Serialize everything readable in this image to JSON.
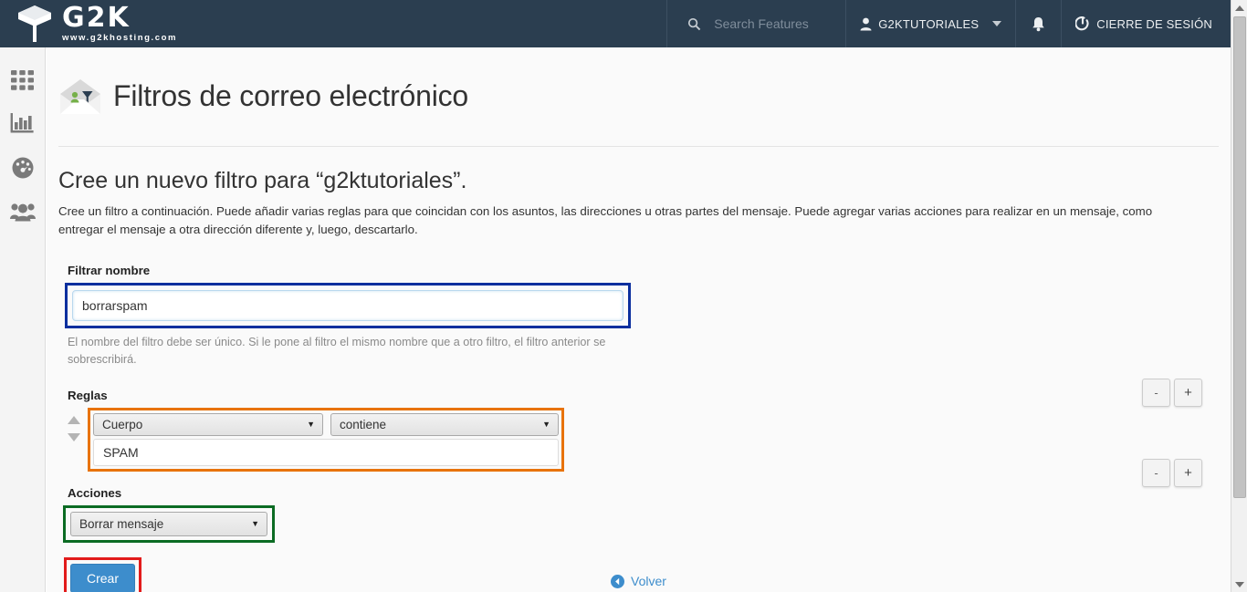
{
  "brand": {
    "name": "G2K",
    "url": "www.g2khosting.com",
    "header_bg": "#2b3e50"
  },
  "header": {
    "search_placeholder": "Search Features",
    "user_label": "G2KTUTORIALES",
    "logout_label": "CIERRE DE SESIÓN",
    "icons": {
      "search": "search-icon",
      "user": "user-icon",
      "bell": "bell-icon",
      "logout": "logout-icon",
      "caret": "chevron-down-icon"
    }
  },
  "sidebar": {
    "items": [
      {
        "name": "apps-grid",
        "label": "Aplicaciones"
      },
      {
        "name": "statistics",
        "label": "Estadísticas"
      },
      {
        "name": "dashboard-gauge",
        "label": "Panel"
      },
      {
        "name": "users",
        "label": "Usuarios"
      }
    ]
  },
  "page": {
    "title": "Filtros de correo electrónico",
    "section_title": "Cree un nuevo filtro para “g2ktutoriales”.",
    "lead": "Cree un filtro a continuación. Puede añadir varias reglas para que coincidan con los asuntos, las direcciones u otras partes del mensaje. Puede agregar varias acciones para realizar en un mensaje, como entregar el mensaje a otra dirección diferente y, luego, descartarlo."
  },
  "form": {
    "name_label": "Filtrar nombre",
    "name_value": "borrarspam",
    "name_placeholder": "",
    "name_help": "El nombre del filtro debe ser único. Si le pone al filtro el mismo nombre que a otro filtro, el filtro anterior se sobrescribirá.",
    "rules_label": "Reglas",
    "rule": {
      "field_selected": "Cuerpo",
      "condition_selected": "contiene",
      "value": "SPAM",
      "value_placeholder": ""
    },
    "actions_label": "Acciones",
    "action": {
      "selected": "Borrar mensaje"
    },
    "remove_label": "-",
    "add_label": "+",
    "submit_label": "Crear"
  },
  "footer": {
    "back_label": "Volver",
    "back_icon": "arrow-left-circle-icon"
  },
  "annotations": {
    "name_box_color": "#0b2f9e",
    "rules_box_color": "#e8730c",
    "actions_box_color": "#0b6b23",
    "create_box_color": "#e21b1b"
  },
  "accent": {
    "primary_button": "#3d8dcc",
    "link": "#3d8dcc"
  }
}
